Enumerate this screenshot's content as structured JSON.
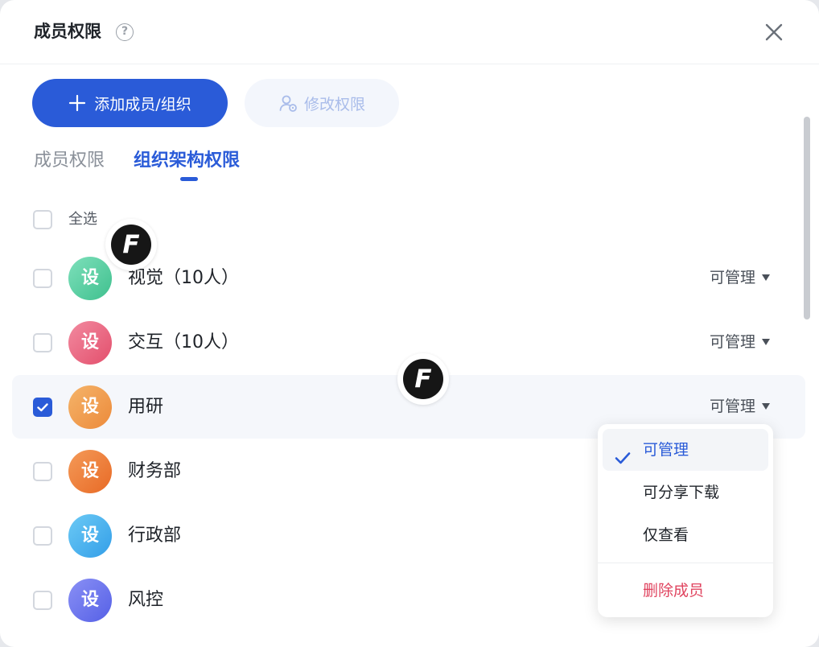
{
  "dialog": {
    "title": "成员权限",
    "help_icon": "question-circle-icon",
    "close_icon": "close-icon"
  },
  "toolbar": {
    "add_label": "添加成员/组织",
    "edit_label": "修改权限"
  },
  "tabs": [
    {
      "label": "成员权限",
      "active": false
    },
    {
      "label": "组织架构权限",
      "active": true
    }
  ],
  "select_all": {
    "label": "全选",
    "checked": false
  },
  "rows": [
    {
      "avatar": "设",
      "name": "视觉（10人）",
      "permission": "可管理",
      "checked": false,
      "avatar_color": "#5cd1a5"
    },
    {
      "avatar": "设",
      "name": "交互（10人）",
      "permission": "可管理",
      "checked": false,
      "avatar_color": "#ec6a82"
    },
    {
      "avatar": "设",
      "name": "用研",
      "permission": "可管理",
      "checked": true,
      "avatar_color": "#f0a052"
    },
    {
      "avatar": "设",
      "name": "财务部",
      "permission": "",
      "checked": false,
      "avatar_color": "#f07f38"
    },
    {
      "avatar": "设",
      "name": "行政部",
      "permission": "",
      "checked": false,
      "avatar_color": "#4ab2ee"
    },
    {
      "avatar": "设",
      "name": "风控",
      "permission": "",
      "checked": false,
      "avatar_color": "#6a72ee"
    }
  ],
  "dropdown": {
    "options": [
      {
        "label": "可管理",
        "selected": true
      },
      {
        "label": "可分享下载",
        "selected": false
      },
      {
        "label": "仅查看",
        "selected": false
      }
    ],
    "delete_label": "删除成员"
  },
  "badge": {
    "letter": "F"
  },
  "colors": {
    "primary": "#2a5bd8",
    "danger": "#e0445f",
    "text": "#1f2329",
    "muted": "#8a9099"
  }
}
